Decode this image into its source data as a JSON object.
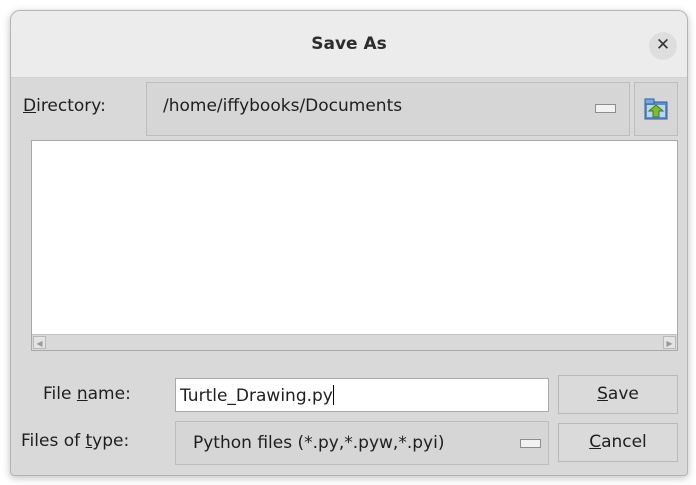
{
  "dialog": {
    "title": "Save As"
  },
  "directory": {
    "label_underline": "D",
    "label_rest": "irectory:",
    "value": "/home/iffybooks/Documents"
  },
  "file_name": {
    "label_pre": "File ",
    "label_underline": "n",
    "label_rest": "ame:",
    "value": "Turtle_Drawing.py"
  },
  "file_type": {
    "label_pre": "Files of ",
    "label_underline": "t",
    "label_rest": "ype:",
    "value": "Python files (*.py,*.pyw,*.pyi)"
  },
  "buttons": {
    "save_underline": "S",
    "save_rest": "ave",
    "cancel_underline": "C",
    "cancel_rest": "ancel"
  },
  "icons": {
    "close": "close-icon",
    "folder_up": "folder-up-icon",
    "scroll_left": "scroll-left-arrow-icon",
    "scroll_right": "scroll-right-arrow-icon"
  },
  "colors": {
    "window_bg": "#d9d9d9",
    "titlebar_bg": "#ececec",
    "folder_icon": "#7dbb3c"
  }
}
